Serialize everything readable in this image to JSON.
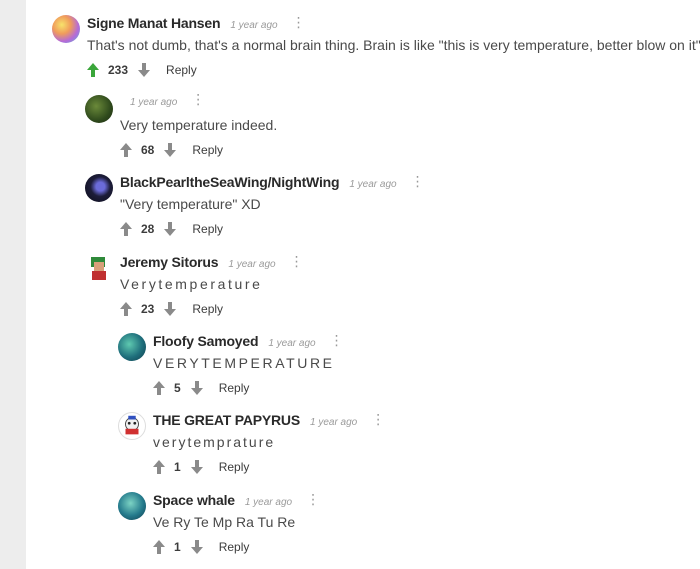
{
  "comments": [
    {
      "author": "Signe Manat Hansen",
      "time": "1 year ago",
      "text": "That's not dumb, that's a normal brain thing. Brain is like \"this is very temperature, better blow on it\"",
      "votes": "233",
      "reply": "Reply"
    },
    {
      "author": "",
      "time": "1 year ago",
      "text": "Very temperature indeed.",
      "votes": "68",
      "reply": "Reply"
    },
    {
      "author": "BlackPearltheSeaWing/NightWing",
      "time": "1 year ago",
      "text": "\"Very temperature\" XD",
      "votes": "28",
      "reply": "Reply"
    },
    {
      "author": "Jeremy Sitorus",
      "time": "1 year ago",
      "text": "Verytemperature",
      "votes": "23",
      "reply": "Reply"
    },
    {
      "author": "Floofy Samoyed",
      "time": "1 year ago",
      "text": "VERYTEMPERATURE",
      "votes": "5",
      "reply": "Reply"
    },
    {
      "author": "THE GREAT PAPYRUS",
      "time": "1 year ago",
      "text": "verytemprature",
      "votes": "1",
      "reply": "Reply"
    },
    {
      "author": "Space whale",
      "time": "1 year ago",
      "text": "Ve Ry Te Mp Ra Tu Re",
      "votes": "1",
      "reply": "Reply"
    }
  ],
  "icons": {
    "more": "more-vertical-icon",
    "upvote": "arrow-up-icon",
    "downvote": "arrow-down-icon"
  },
  "colors": {
    "upvote_active": "#3aa63a",
    "vote_idle": "#8a8a8a",
    "gutter": "#ededed"
  }
}
